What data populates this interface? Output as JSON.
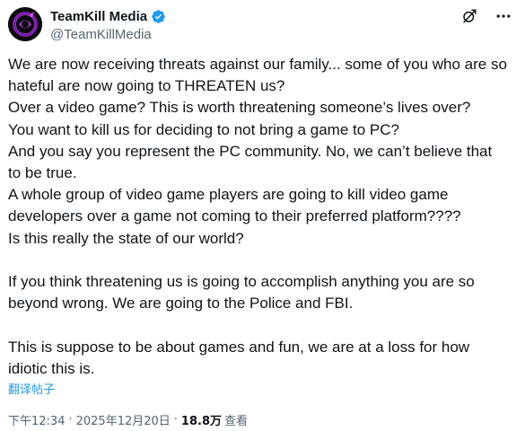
{
  "header": {
    "display_name": "TeamKill Media",
    "handle": "@TeamKillMedia"
  },
  "icons": {
    "avatar": "teamkill-logo-icon",
    "verified": "verified-badge-icon",
    "grok": "grok-icon",
    "more": "more-options-icon"
  },
  "colors": {
    "accent": "#1d9bf0",
    "text": "#0f1419",
    "secondary": "#536471"
  },
  "post": {
    "lines": [
      "We are now receiving threats against our family... some of you who are so",
      "hateful are now going to THREATEN us?",
      "Over a video game?  This is worth threatening someone’s lives over?",
      "You want to kill us for deciding to not bring a game to PC?",
      "And you say you represent the PC community. No, we can’t believe that",
      "to be true.",
      "A whole group of video game players are going to kill video game",
      "developers over a game not coming to their preferred platform????",
      "Is this really the state of our world?",
      "",
      "If you think threatening us is going to accomplish anything you are so",
      "beyond wrong.  We are going to the Police and FBI.",
      "",
      "This is suppose to be about games and fun, we are at a loss for how",
      "idiotic this is."
    ],
    "translate_label": "翻译帖子"
  },
  "meta": {
    "time": "下午12:34",
    "separator": "·",
    "date": "2025年12月20日",
    "views_count": "18.8万",
    "views_label": "查看"
  }
}
